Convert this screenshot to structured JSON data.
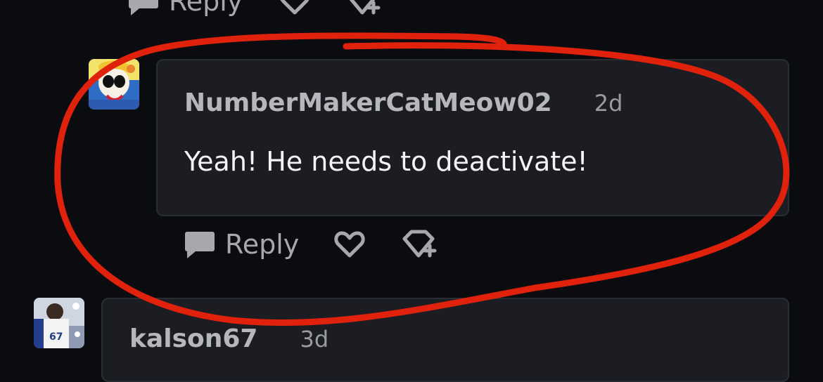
{
  "top_actions": {
    "reply_label": "Reply"
  },
  "comment1": {
    "username": "NumberMakerCatMeow02",
    "time": "2d",
    "text": "Yeah! He needs to deactivate!",
    "actions": {
      "reply_label": "Reply"
    }
  },
  "comment2": {
    "username": "kalson67",
    "time": "3d"
  },
  "annotation_color": "#e0220c"
}
